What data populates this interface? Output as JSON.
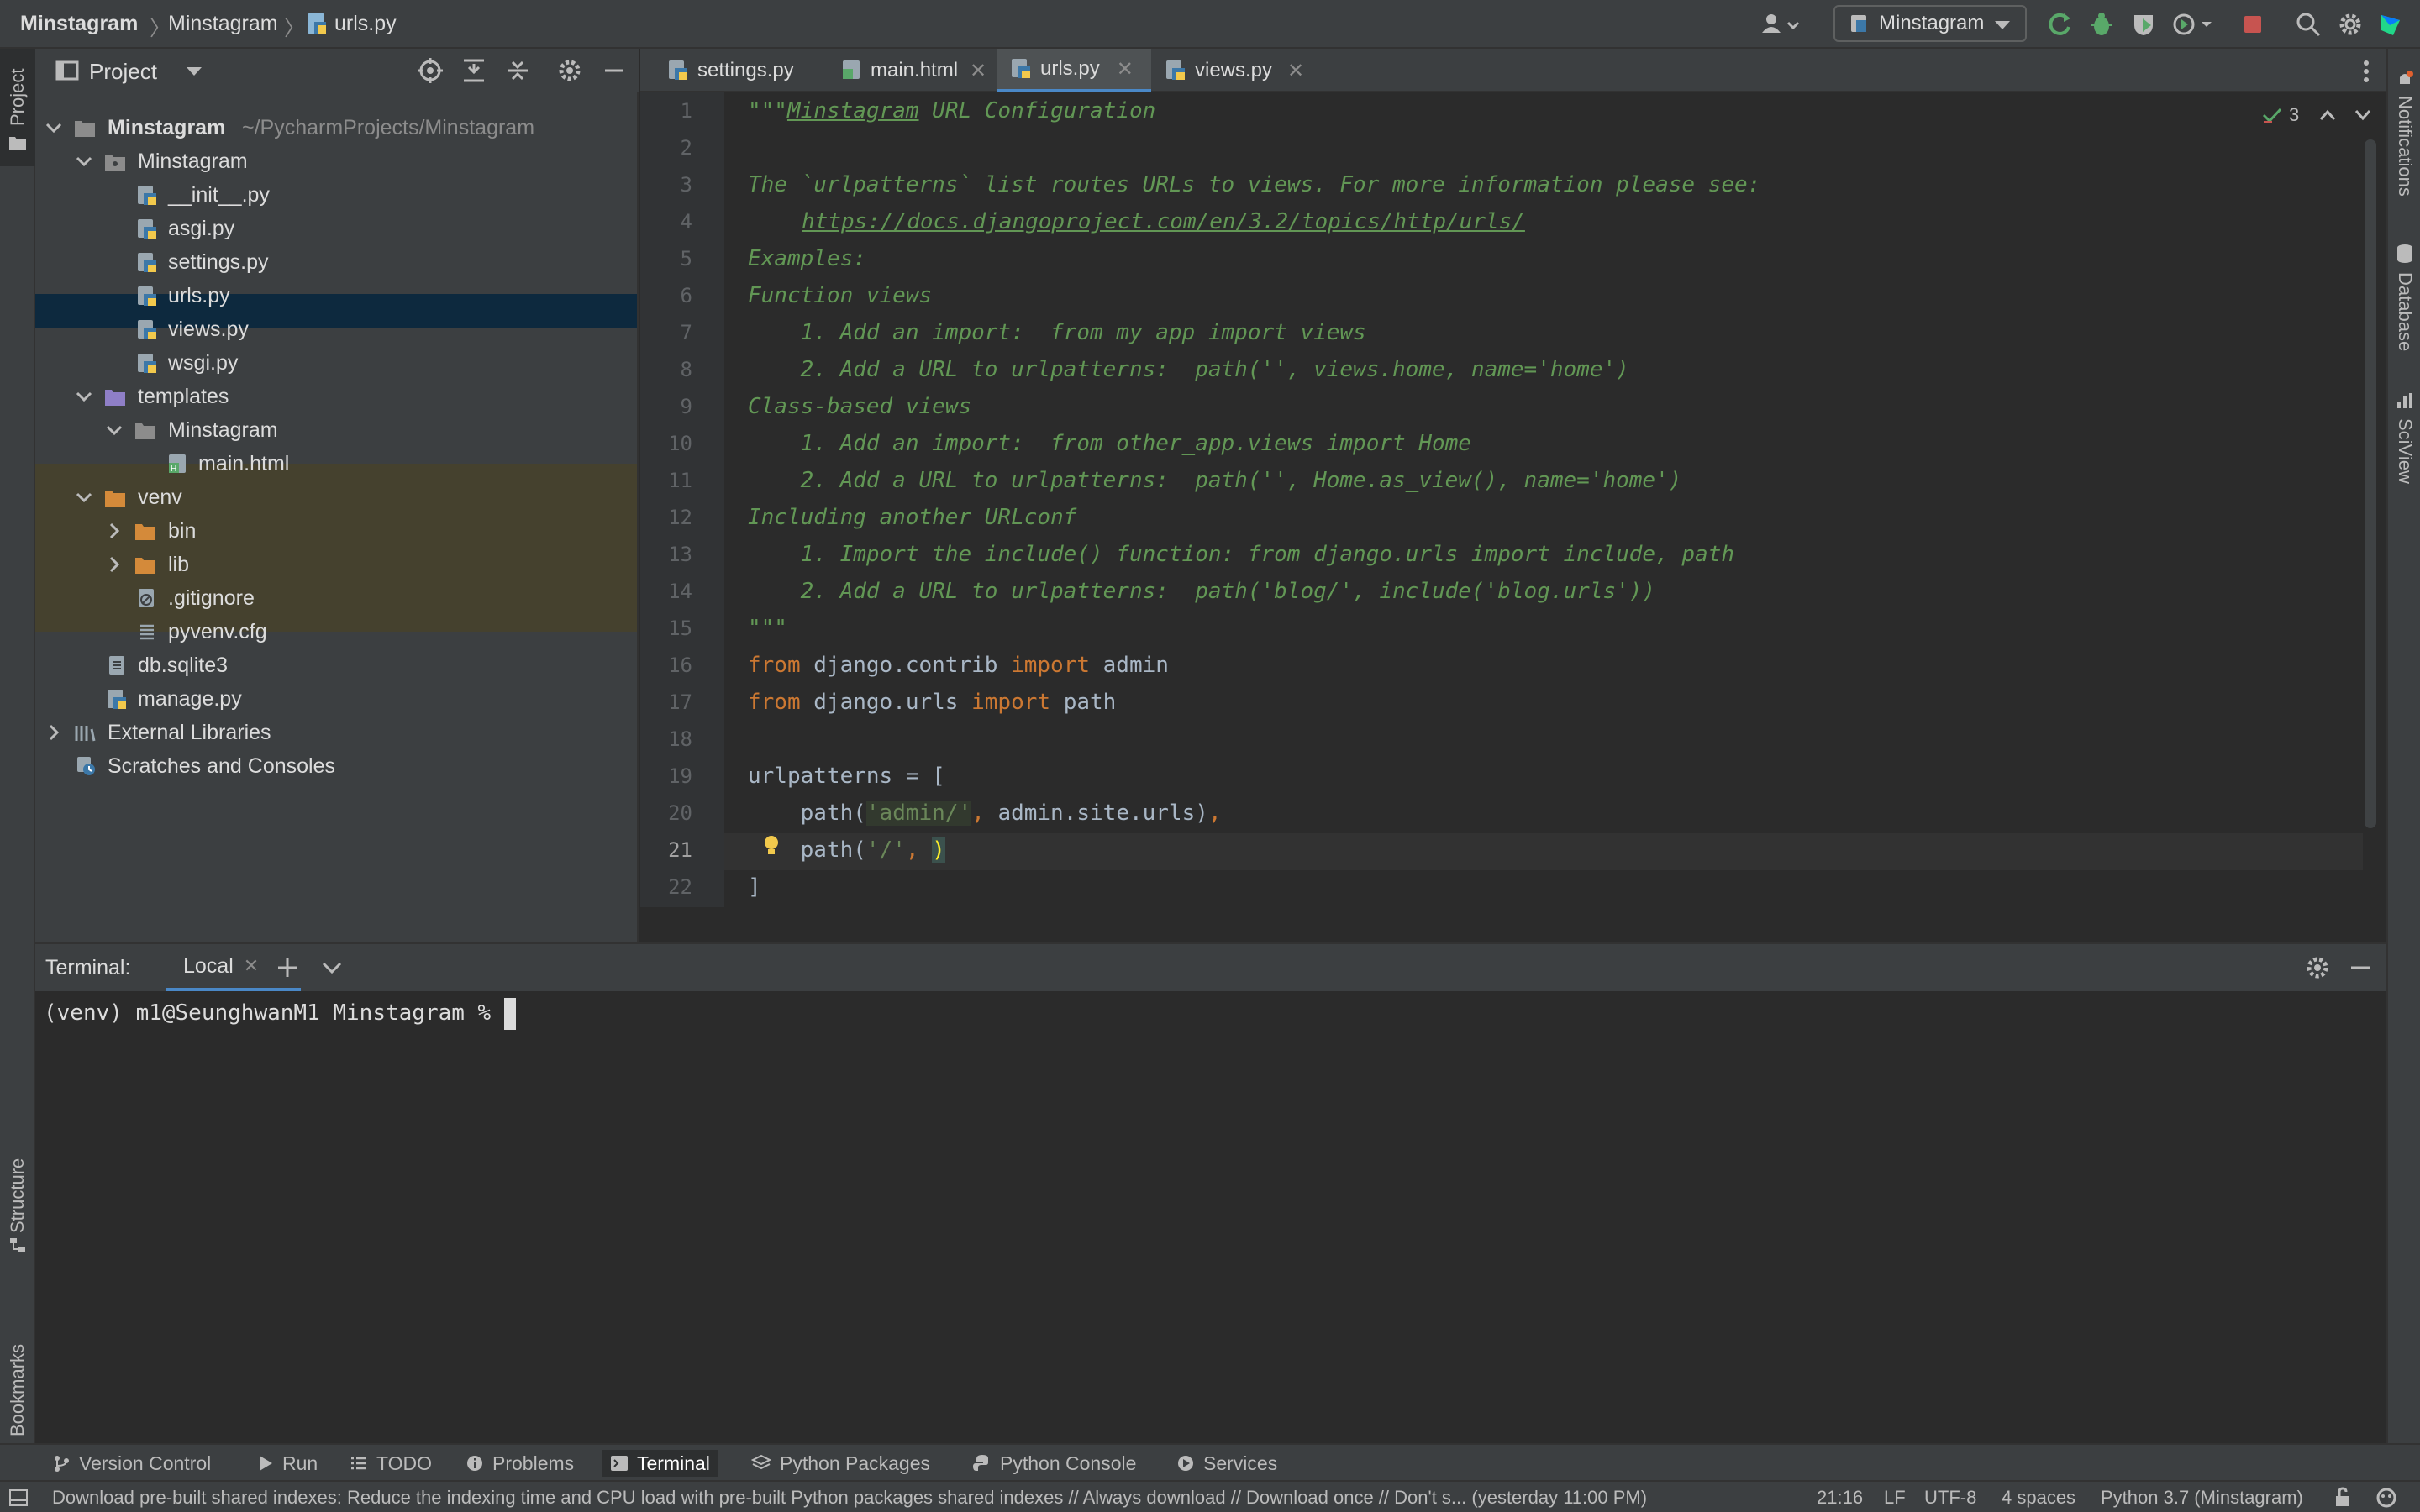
{
  "titlebar": {
    "project": "Minstagram",
    "folder": "Minstagram",
    "file": "urls.py",
    "run_config": "Minstagram"
  },
  "left_stripe": {
    "project": "Project",
    "structure": "Structure",
    "bookmarks": "Bookmarks"
  },
  "right_stripe": {
    "notifications": "Notifications",
    "database": "Database",
    "sciview": "SciView"
  },
  "project_panel": {
    "title": "Project",
    "tree": [
      {
        "label": "Minstagram",
        "path": "~/PycharmProjects/Minstagram",
        "kind": "root"
      },
      {
        "label": "Minstagram",
        "kind": "package"
      },
      {
        "label": "__init__.py",
        "kind": "py"
      },
      {
        "label": "asgi.py",
        "kind": "py"
      },
      {
        "label": "settings.py",
        "kind": "py"
      },
      {
        "label": "urls.py",
        "kind": "py"
      },
      {
        "label": "views.py",
        "kind": "py",
        "selected": true
      },
      {
        "label": "wsgi.py",
        "kind": "py"
      },
      {
        "label": "templates",
        "kind": "folder-purple"
      },
      {
        "label": "Minstagram",
        "kind": "folder"
      },
      {
        "label": "main.html",
        "kind": "html"
      },
      {
        "label": "venv",
        "kind": "folder-orange"
      },
      {
        "label": "bin",
        "kind": "folder-orange"
      },
      {
        "label": "lib",
        "kind": "folder-orange"
      },
      {
        "label": ".gitignore",
        "kind": "gitignore"
      },
      {
        "label": "pyvenv.cfg",
        "kind": "cfg"
      },
      {
        "label": "db.sqlite3",
        "kind": "db"
      },
      {
        "label": "manage.py",
        "kind": "py"
      },
      {
        "label": "External Libraries",
        "kind": "lib"
      },
      {
        "label": "Scratches and Consoles",
        "kind": "scratch"
      }
    ]
  },
  "editor": {
    "tabs": [
      {
        "label": "settings.py"
      },
      {
        "label": "main.html"
      },
      {
        "label": "urls.py",
        "active": true
      },
      {
        "label": "views.py"
      }
    ],
    "inspection_count": "3",
    "lines": [
      "1",
      "2",
      "3",
      "4",
      "5",
      "6",
      "7",
      "8",
      "9",
      "10",
      "11",
      "12",
      "13",
      "14",
      "15",
      "16",
      "17",
      "18",
      "19",
      "20",
      "21",
      "22"
    ],
    "code": {
      "l1a": "\"\"\"",
      "l1b": "Minstagram",
      "l1c": " URL Configuration",
      "l3": "The `urlpatterns` list routes URLs to views. For more information please see:",
      "l4": "https://docs.djangoproject.com/en/3.2/topics/http/urls/",
      "l5": "Examples:",
      "l6": "Function views",
      "l7": "    1. Add an import:  from my_app import views",
      "l8": "    2. Add a URL to urlpatterns:  path('', views.home, name='home')",
      "l9": "Class-based views",
      "l10": "    1. Add an import:  from other_app.views import Home",
      "l11": "    2. Add a URL to urlpatterns:  path('', Home.as_view(), name='home')",
      "l12": "Including another URLconf",
      "l13": "    1. Import the include() function: from django.urls import include, path",
      "l14": "    2. Add a URL to urlpatterns:  path('blog/', include('blog.urls'))",
      "l15": "\"\"\"",
      "from": "from",
      "import": "import",
      "l16_mod": " django.contrib ",
      "l16_name": " admin",
      "l17_mod": " django.urls ",
      "l17_name": " path",
      "l19": "urlpatterns = [",
      "l20_a": "    path(",
      "l20_b": "'admin/'",
      "l20_c": ", ",
      "l20_d": "admin.site.urls)",
      "l20_e": ",",
      "l21_a": "    path(",
      "l21_b": "'/'",
      "l21_c": ", ",
      "l21_d": ")",
      "l22": "]"
    }
  },
  "terminal": {
    "label": "Terminal:",
    "tab": "Local",
    "prompt": "(venv) m1@SeunghwanM1 Minstagram % "
  },
  "toolwindows": [
    {
      "label": "Version Control",
      "icon": "branch-icon"
    },
    {
      "label": "Run",
      "icon": "play-icon"
    },
    {
      "label": "TODO",
      "icon": "list-icon"
    },
    {
      "label": "Problems",
      "icon": "info-icon"
    },
    {
      "label": "Terminal",
      "icon": "terminal-icon",
      "active": true
    },
    {
      "label": "Python Packages",
      "icon": "layers-icon"
    },
    {
      "label": "Python Console",
      "icon": "python-icon"
    },
    {
      "label": "Services",
      "icon": "services-icon"
    }
  ],
  "status": {
    "message": "Download pre-built shared indexes: Reduce the indexing time and CPU load with pre-built Python packages shared indexes // Always download // Download once // Don't s... (yesterday 11:00 PM)",
    "position": "21:16",
    "line_sep": "LF",
    "encoding": "UTF-8",
    "indent": "4 spaces",
    "interpreter": "Python 3.7 (Minstagram)"
  },
  "colors": {
    "accent": "#4a88c7",
    "selection": "#0d293e",
    "venv_bg": "#45412e",
    "doc": "#629755",
    "keyword": "#cc7832"
  }
}
